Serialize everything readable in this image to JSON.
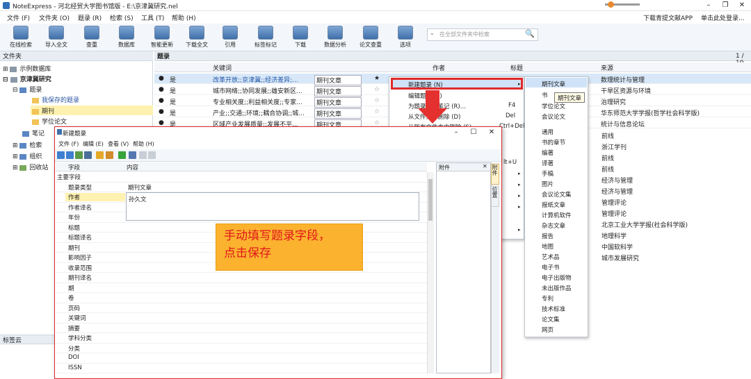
{
  "window": {
    "title": "NoteExpress - 河北经贸大学图书馆版 - E:\\京津冀研究.nel",
    "min": "–",
    "max": "❐",
    "close": "✕"
  },
  "menubar": {
    "items": [
      "文件 (F)",
      "文件夹 (O)",
      "题录 (R)",
      "检索 (S)",
      "工具 (T)",
      "帮助 (H)"
    ],
    "right_items": [
      "下载青提文献APP",
      "单击此处登录..."
    ]
  },
  "toolbar": {
    "buttons": [
      "在线检索",
      "导入全文",
      "查重",
      "数据库",
      "智能更新",
      "下载全文",
      "引用",
      "标签标记",
      "下载",
      "数据分析",
      "论文查重",
      "选项"
    ]
  },
  "search": {
    "placeholder": "在全部文件夹中检索",
    "chevron": "⌄",
    "icon": "🔍"
  },
  "left": {
    "header": "文件夹",
    "tree": [
      "示例数据库",
      "京津冀研究",
      "题录",
      "我保存的题录",
      "期刊",
      "学位论文",
      "笔记",
      "检索",
      "组织",
      "回收站"
    ],
    "expanders": [
      "⊞",
      "⊟",
      "⊟",
      "",
      "",
      "",
      "",
      "⊞",
      "⊞",
      "⊞"
    ],
    "tagcloud": "标签云"
  },
  "main": {
    "header": "题录",
    "page": "1 / 10",
    "columns": [
      "关键词",
      "作者",
      "标题",
      "来源"
    ],
    "rows": [
      {
        "read": "是",
        "keywords": "改革开放;;京津冀;;经济差异;...",
        "type": "期刊文章",
        "source": "数理统计与管理"
      },
      {
        "read": "是",
        "keywords": "城市网络;;协同发展;;雄安新区...",
        "type": "期刊文章",
        "source": "干旱区资源与环境"
      },
      {
        "read": "是",
        "keywords": "专业相关度;;利益相关度;;专家...",
        "type": "期刊文章",
        "source": "治理研究"
      },
      {
        "read": "是",
        "keywords": "产业;;交通;;环境;;耦合协调;;城...",
        "type": "期刊文章",
        "source": "华东师范大学学报(哲学社会科学版)"
      },
      {
        "read": "是",
        "keywords": "区域产业发展质量;;发展不平...",
        "type": "期刊文章",
        "source": "统计与信息论坛"
      }
    ],
    "more_sources": [
      "前线",
      "浙江学刊",
      "前线",
      "前线",
      "经济与管理",
      "经济与管理",
      "管理评论",
      "管理评论",
      "北京工业大学学报(社会科学版)",
      "地理科学",
      "中国软科学",
      "城市发展研究"
    ]
  },
  "context_menu": {
    "items": [
      {
        "label": "新建题录 (N)",
        "shortcut": "",
        "arrow": "▸"
      },
      {
        "label": "编辑题录 (E)",
        "shortcut": "",
        "arrow": ""
      },
      {
        "label": "为题录添加笔记 (R)...",
        "shortcut": "F4",
        "arrow": ""
      },
      {
        "label": "从文件夹中删除 (D)",
        "shortcut": "Del",
        "arrow": ""
      },
      {
        "label": "从所有文件夹中删除 (S)",
        "shortcut": "Ctrl+Del",
        "arrow": ""
      }
    ],
    "partial_shortcut": "lt+U",
    "extra_arrows": [
      "▸",
      "▸",
      "▸",
      "▸",
      "▸",
      "▸",
      "▸"
    ]
  },
  "submenu": {
    "items": [
      "期刊文章",
      "书",
      "学位论文",
      "会议论文",
      "通用",
      "书的章节",
      "编著",
      "译著",
      "手稿",
      "图片",
      "会议论文集",
      "报纸文章",
      "计算机软件",
      "杂志文章",
      "报告",
      "地图",
      "艺术品",
      "电子书",
      "电子出版物",
      "未出版作品",
      "专利",
      "技术标准",
      "论文集",
      "网页"
    ],
    "tooltip": "期刊文章"
  },
  "dialog": {
    "title": "新建题录",
    "menu": [
      "文件 (F)",
      "编辑 (E)",
      "查看 (V)",
      "帮助 (H)"
    ],
    "col_field": "字段",
    "col_content": "内容",
    "group": "主要字段",
    "fields": [
      "题录类型",
      "作者",
      "作者译名",
      "年份",
      "标题",
      "标题译名",
      "期刊",
      "影响因子",
      "收录范围",
      "期刊译名",
      "期",
      "卷",
      "页码",
      "关键词",
      "摘要",
      "学科分类",
      "分类",
      "DOI",
      "ISSN"
    ],
    "type_value": "期刊文章",
    "author_value": "孙久文",
    "attach_header": "附件",
    "attach_close": "✕",
    "side_tabs": [
      "附件",
      "位置"
    ]
  },
  "note": {
    "text": "手动填写题录字段，\n点击保存"
  },
  "colors": {
    "highlight_border": "#e02a2a",
    "arrow": "#e53030",
    "note_bg": "#fbb22f",
    "note_text": "#e0161b",
    "selection": "#cfe2f7"
  }
}
